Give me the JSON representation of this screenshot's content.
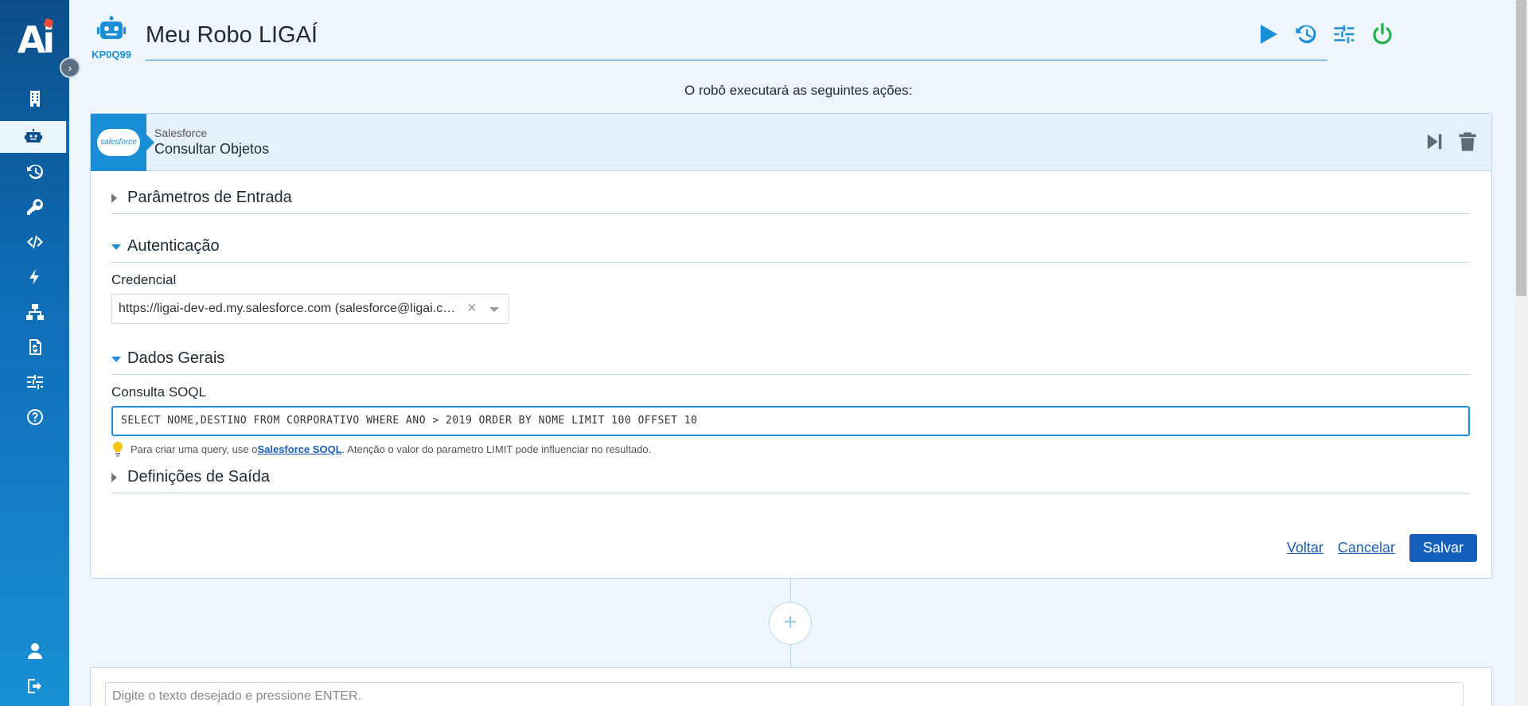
{
  "sidebar": {
    "logo_text": "Ai",
    "items": [
      {
        "name": "companies",
        "icon": "building-icon"
      },
      {
        "name": "robots",
        "icon": "robot-icon"
      },
      {
        "name": "history",
        "icon": "history-icon"
      },
      {
        "name": "keys",
        "icon": "key-icon"
      },
      {
        "name": "code",
        "icon": "code-icon"
      },
      {
        "name": "triggers",
        "icon": "bolt-icon"
      },
      {
        "name": "network",
        "icon": "network-icon"
      },
      {
        "name": "billing",
        "icon": "invoice-icon"
      },
      {
        "name": "settings",
        "icon": "sliders-icon"
      },
      {
        "name": "help",
        "icon": "help-icon"
      },
      {
        "name": "profile",
        "icon": "user-icon"
      },
      {
        "name": "logout",
        "icon": "logout-icon"
      }
    ]
  },
  "header": {
    "robot_code": "KP0Q99",
    "title": "Meu Robo LIGAÍ"
  },
  "subtitle": "O robô executará as seguintes ações:",
  "action": {
    "service": "Salesforce",
    "service_logo": "salesforce",
    "name": "Consultar Objetos"
  },
  "sections": {
    "input_params": "Parâmetros de Entrada",
    "auth": "Autenticação",
    "general": "Dados Gerais",
    "output": "Definições de Saída"
  },
  "credential": {
    "label": "Credencial",
    "value": "https://ligai-dev-ed.my.salesforce.com (salesforce@ligai.com)"
  },
  "soql": {
    "label": "Consulta SOQL",
    "value": "SELECT NOME,DESTINO FROM CORPORATIVO WHERE ANO > 2019 ORDER BY NOME LIMIT 100 OFFSET 10",
    "hint_prefix": "Para criar uma query, use o",
    "hint_link": "Salesforce SOQL",
    "hint_suffix": ". Atenção o valor do parametro LIMIT pode influenciar no resultado."
  },
  "buttons": {
    "back": "Voltar",
    "cancel": "Cancelar",
    "save": "Salvar"
  },
  "add_step": "+",
  "chat_input": {
    "placeholder": "Digite o texto desejado e pressione ENTER."
  },
  "colors": {
    "accent": "#1a8fd8",
    "sidebar_dark": "#0b4f8a",
    "save": "#1560bd",
    "power": "#22b14c"
  }
}
